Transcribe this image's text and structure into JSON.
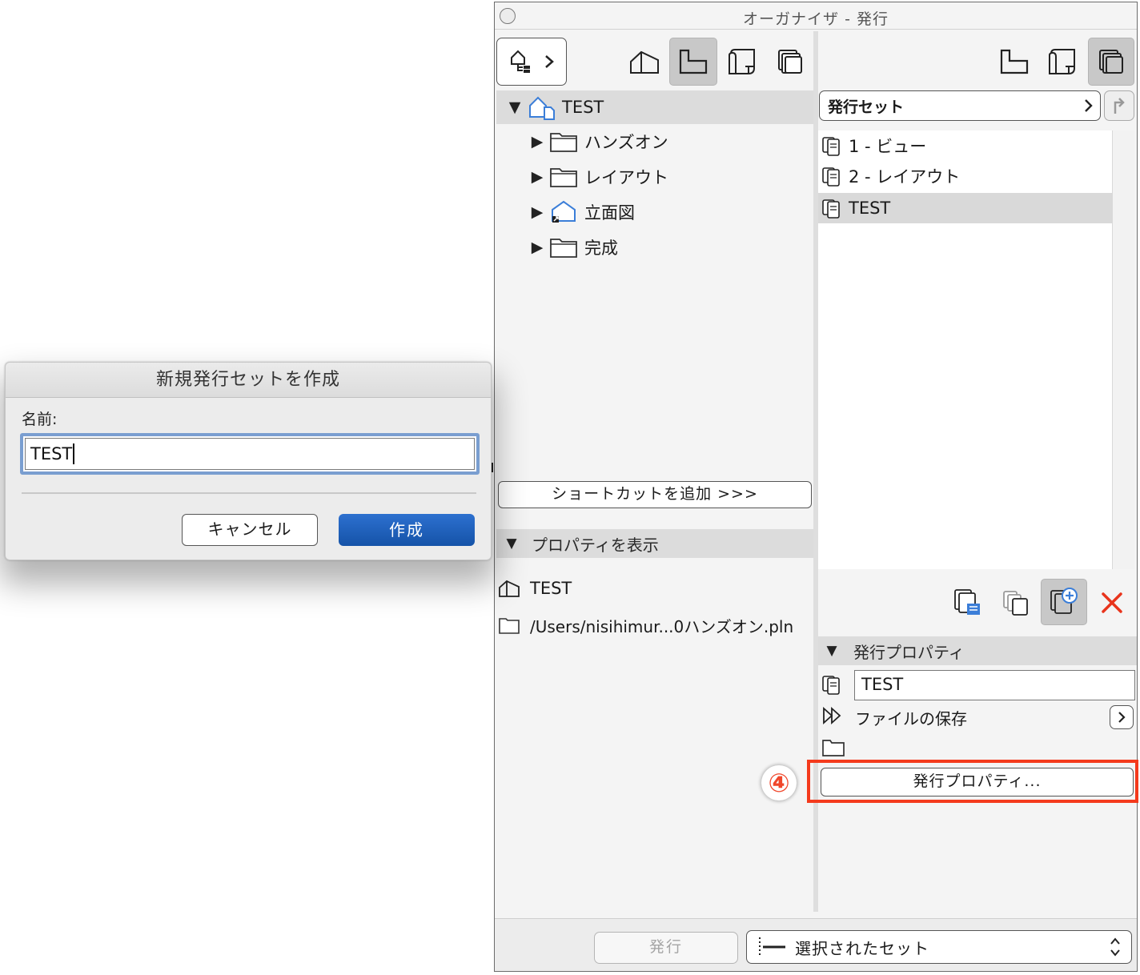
{
  "window": {
    "title": "オーガナイザ - 発行"
  },
  "toolbar_left": {
    "nav_icon": "project-map-icon",
    "nav_arrow_icon": "chevron-right-icon",
    "icons": [
      "project-map-icon",
      "view-map-icon",
      "layout-book-icon",
      "publisher-sets-icon"
    ],
    "active": "view-map-icon"
  },
  "toolbar_right": {
    "icons": [
      "view-map-icon",
      "layout-book-icon",
      "publisher-sets-icon"
    ],
    "active": "publisher-sets-icon"
  },
  "tree": {
    "root_label": "TEST",
    "items": [
      {
        "label": "ハンズオン",
        "icon": "folder-icon"
      },
      {
        "label": "レイアウト",
        "icon": "folder-icon"
      },
      {
        "label": "立面図",
        "icon": "elevation-shortcut-icon"
      },
      {
        "label": "完成",
        "icon": "folder-icon"
      }
    ]
  },
  "shortcut_button": {
    "label": "ショートカットを追加 >>>"
  },
  "properties": {
    "header": "プロパティを表示",
    "name": "TEST",
    "path": "/Users/nisihimur...0ハンズオン.pln"
  },
  "publisher": {
    "set_selector_label": "発行セット",
    "sets": [
      {
        "label": "1 - ビュー"
      },
      {
        "label": "2 - レイアウト"
      },
      {
        "label": "TEST"
      }
    ],
    "selected_index": 2,
    "actions": [
      "set-settings-icon",
      "duplicate-set-icon",
      "new-set-icon",
      "delete-icon"
    ]
  },
  "publish_properties": {
    "header": "発行プロパティ",
    "name_value": "TEST",
    "method_label": "ファイルの保存",
    "properties_button": "発行プロパティ...",
    "step_number": "④",
    "highlight_color": "#f43a1c"
  },
  "bottom_bar": {
    "publish_button": "発行",
    "selector_label": "選択されたセット"
  },
  "dialog": {
    "title": "新規発行セットを作成",
    "name_label": "名前:",
    "name_value": "TEST",
    "cancel_label": "キャンセル",
    "create_label": "作成",
    "accent_color": "#1a5fbf"
  }
}
